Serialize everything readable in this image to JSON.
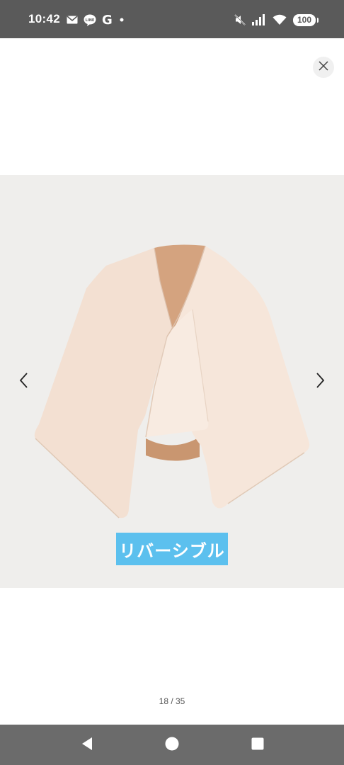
{
  "status_bar": {
    "time": "10:42",
    "left_icons": [
      "mail-icon",
      "line-icon",
      "google-icon",
      "dot-icon"
    ],
    "google_letter": "G",
    "right_icons": [
      "mute-icon",
      "signal-icon",
      "wifi-icon",
      "battery-icon"
    ],
    "battery_level": "100"
  },
  "viewer": {
    "close_icon": "close-icon",
    "prev_icon": "chevron-left-icon",
    "next_icon": "chevron-right-icon",
    "caption": "リバーシブル",
    "page_counter": "18 / 35",
    "current_page": 18,
    "total_pages": 35
  },
  "colors": {
    "status_bar_bg": "#5a5a5a",
    "image_bg": "#efeeec",
    "garment_outer": "#f3e0d2",
    "garment_inner": "#d4a37f",
    "caption_bg": "#5cc0ee",
    "nav_bar_bg": "#6b6b6b"
  },
  "nav_bar": {
    "buttons": [
      "back-icon",
      "home-icon",
      "recents-icon"
    ]
  }
}
